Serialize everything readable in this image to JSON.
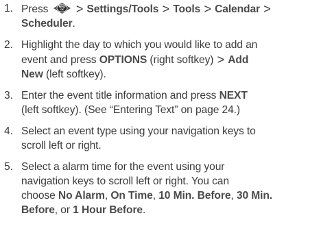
{
  "steps": [
    {
      "number": "1.",
      "press": "Press",
      "icon": "menu-ok-key-icon",
      "icon_top_text": "MENU",
      "icon_bottom_text": "OK",
      "separator": ">",
      "path": [
        "Settings/Tools",
        "Tools",
        "Calendar",
        "Scheduler"
      ],
      "end": "."
    },
    {
      "number": "2.",
      "line1": "Highlight the day to which you would like to add an",
      "line2_a": "event and press ",
      "options": "OPTIONS",
      "line2_b": " (right softkey) ",
      "separator": ">",
      "add": "Add",
      "new": "New",
      "line3_rest": " (left softkey)."
    },
    {
      "number": "3.",
      "line1_a": "Enter the event title information and press ",
      "next": "NEXT",
      "line2": "(left softkey). (See “Entering Text” on page 24.)"
    },
    {
      "number": "4.",
      "line1": "Select an event type using your navigation keys to",
      "line2": "scroll left or right."
    },
    {
      "number": "5.",
      "line1": "Select a alarm time for the event using your",
      "line2": "navigation keys to scroll left or right. You can",
      "line3_a": "choose ",
      "opt1": "No Alarm",
      "c1": ", ",
      "opt2": "On Time",
      "c2": ", ",
      "opt3": "10 Min. Before",
      "c3": ", ",
      "opt4a": "30 Min.",
      "opt4b": "Before",
      "c4": ", or ",
      "opt5": "1 Hour Before",
      "end": "."
    }
  ]
}
